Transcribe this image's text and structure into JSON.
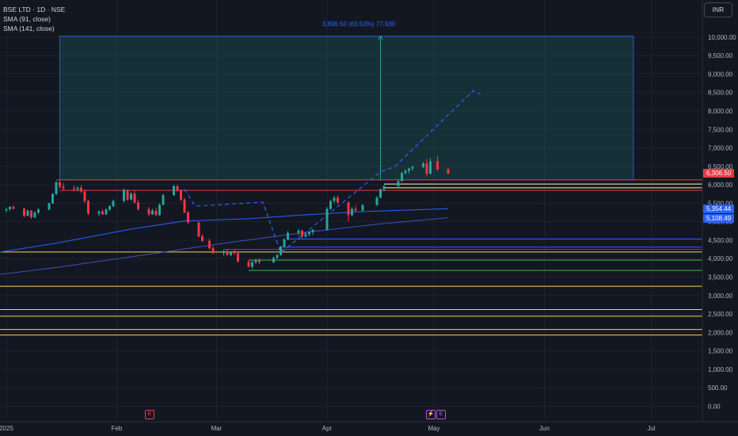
{
  "legend": {
    "symbol": "BSE LTD · 1D · NSE",
    "sma1": "SMA (91, close)",
    "sma2": "SMA (141, close)"
  },
  "currency": "INR",
  "measure_label": "3,896.50 (63.53%) 77,930",
  "events": [
    {
      "icon": "E",
      "date": "2025-02-06",
      "color": "#f23645"
    },
    {
      "icon": "⚡",
      "date": "2025-04-28",
      "color": "#b84fd6"
    },
    {
      "icon": "E",
      "date": "2025-05-01",
      "color": "#b84fd6"
    }
  ],
  "chart_data": {
    "type": "candlestick",
    "y_ticks": [
      "10,000.00",
      "9,500.00",
      "9,000.00",
      "8,500.00",
      "8,000.00",
      "7,500.00",
      "7,000.00",
      "6,500.00",
      "6,000.00",
      "5,500.00",
      "5,000.00",
      "4,500.00",
      "4,000.00",
      "3,500.00",
      "3,000.00",
      "2,500.00",
      "2,000.00",
      "1,500.00",
      "1,000.00",
      "500.00",
      "0.00"
    ],
    "y_tick_values": [
      10000,
      9500,
      9000,
      8500,
      8000,
      7500,
      7000,
      6500,
      6000,
      5500,
      5000,
      4500,
      4000,
      3500,
      3000,
      2500,
      2000,
      1500,
      1000,
      500,
      0
    ],
    "ylim": [
      -200,
      10900
    ],
    "x_ticks": [
      {
        "label": "2025",
        "date": "2025-01-01"
      },
      {
        "label": "Feb",
        "date": "2025-02-01"
      },
      {
        "label": "Mar",
        "date": "2025-03-01"
      },
      {
        "label": "Apr",
        "date": "2025-04-01"
      },
      {
        "label": "May",
        "date": "2025-05-01"
      },
      {
        "label": "Jun",
        "date": "2025-06-01"
      },
      {
        "label": "Jul",
        "date": "2025-07-01"
      }
    ],
    "candles": [
      {
        "date": "2025-01-01",
        "o": 5310,
        "h": 5380,
        "l": 5250,
        "c": 5340
      },
      {
        "date": "2025-01-02",
        "o": 5340,
        "h": 5420,
        "l": 5300,
        "c": 5400
      },
      {
        "date": "2025-01-03",
        "o": 5400,
        "h": 5440,
        "l": 5330,
        "c": 5350
      },
      {
        "date": "2025-01-06",
        "o": 5350,
        "h": 5380,
        "l": 5120,
        "c": 5160
      },
      {
        "date": "2025-01-07",
        "o": 5160,
        "h": 5330,
        "l": 5140,
        "c": 5300
      },
      {
        "date": "2025-01-08",
        "o": 5300,
        "h": 5320,
        "l": 5080,
        "c": 5120
      },
      {
        "date": "2025-01-09",
        "o": 5120,
        "h": 5280,
        "l": 5090,
        "c": 5250
      },
      {
        "date": "2025-01-10",
        "o": 5250,
        "h": 5360,
        "l": 5200,
        "c": 5330
      },
      {
        "date": "2025-01-13",
        "o": 5330,
        "h": 5520,
        "l": 5310,
        "c": 5500
      },
      {
        "date": "2025-01-14",
        "o": 5500,
        "h": 5780,
        "l": 5480,
        "c": 5750
      },
      {
        "date": "2025-01-15",
        "o": 5750,
        "h": 6100,
        "l": 5720,
        "c": 6070
      },
      {
        "date": "2025-01-16",
        "o": 6070,
        "h": 6133,
        "l": 5900,
        "c": 5950
      },
      {
        "date": "2025-01-17",
        "o": 5950,
        "h": 6050,
        "l": 5860,
        "c": 5900
      },
      {
        "date": "2025-01-20",
        "o": 5900,
        "h": 5980,
        "l": 5820,
        "c": 5880
      },
      {
        "date": "2025-01-21",
        "o": 5880,
        "h": 5960,
        "l": 5820,
        "c": 5920
      },
      {
        "date": "2025-01-22",
        "o": 5920,
        "h": 5990,
        "l": 5780,
        "c": 5820
      },
      {
        "date": "2025-01-23",
        "o": 5820,
        "h": 5870,
        "l": 5500,
        "c": 5560
      },
      {
        "date": "2025-01-24",
        "o": 5560,
        "h": 5600,
        "l": 5180,
        "c": 5220
      },
      {
        "date": "2025-01-27",
        "o": 5220,
        "h": 5300,
        "l": 5150,
        "c": 5280
      },
      {
        "date": "2025-01-28",
        "o": 5280,
        "h": 5330,
        "l": 5180,
        "c": 5200
      },
      {
        "date": "2025-01-29",
        "o": 5200,
        "h": 5360,
        "l": 5180,
        "c": 5330
      },
      {
        "date": "2025-01-30",
        "o": 5330,
        "h": 5450,
        "l": 5290,
        "c": 5420
      },
      {
        "date": "2025-01-31",
        "o": 5420,
        "h": 5600,
        "l": 5400,
        "c": 5560
      },
      {
        "date": "2025-02-03",
        "o": 5560,
        "h": 5900,
        "l": 5520,
        "c": 5860
      },
      {
        "date": "2025-02-04",
        "o": 5860,
        "h": 5880,
        "l": 5560,
        "c": 5600
      },
      {
        "date": "2025-02-05",
        "o": 5600,
        "h": 5800,
        "l": 5580,
        "c": 5760
      },
      {
        "date": "2025-02-06",
        "o": 5760,
        "h": 5830,
        "l": 5480,
        "c": 5520
      },
      {
        "date": "2025-02-07",
        "o": 5520,
        "h": 5600,
        "l": 5300,
        "c": 5340
      },
      {
        "date": "2025-02-10",
        "o": 5340,
        "h": 5400,
        "l": 5150,
        "c": 5200
      },
      {
        "date": "2025-02-11",
        "o": 5200,
        "h": 5350,
        "l": 5180,
        "c": 5300
      },
      {
        "date": "2025-02-12",
        "o": 5300,
        "h": 5380,
        "l": 5150,
        "c": 5180
      },
      {
        "date": "2025-02-13",
        "o": 5180,
        "h": 5500,
        "l": 5160,
        "c": 5460
      },
      {
        "date": "2025-02-14",
        "o": 5460,
        "h": 5750,
        "l": 5440,
        "c": 5720
      },
      {
        "date": "2025-02-17",
        "o": 5720,
        "h": 6000,
        "l": 5700,
        "c": 5960
      },
      {
        "date": "2025-02-18",
        "o": 5960,
        "h": 6010,
        "l": 5800,
        "c": 5850
      },
      {
        "date": "2025-02-19",
        "o": 5850,
        "h": 5880,
        "l": 5560,
        "c": 5600
      },
      {
        "date": "2025-02-20",
        "o": 5600,
        "h": 5650,
        "l": 5230,
        "c": 5250
      },
      {
        "date": "2025-02-21",
        "o": 5250,
        "h": 5300,
        "l": 4950,
        "c": 4980
      },
      {
        "date": "2025-02-24",
        "o": 4980,
        "h": 5000,
        "l": 4580,
        "c": 4600
      },
      {
        "date": "2025-02-25",
        "o": 4600,
        "h": 4660,
        "l": 4460,
        "c": 4480
      },
      {
        "date": "2025-02-27",
        "o": 4480,
        "h": 4540,
        "l": 4250,
        "c": 4280
      },
      {
        "date": "2025-02-28",
        "o": 4280,
        "h": 4350,
        "l": 4120,
        "c": 4150
      },
      {
        "date": "2025-03-03",
        "o": 4150,
        "h": 4240,
        "l": 4080,
        "c": 4200
      },
      {
        "date": "2025-03-04",
        "o": 4200,
        "h": 4260,
        "l": 4080,
        "c": 4100
      },
      {
        "date": "2025-03-05",
        "o": 4100,
        "h": 4200,
        "l": 4060,
        "c": 4180
      },
      {
        "date": "2025-03-06",
        "o": 4180,
        "h": 4250,
        "l": 4100,
        "c": 4150
      },
      {
        "date": "2025-03-07",
        "o": 4150,
        "h": 4180,
        "l": 3900,
        "c": 3920
      },
      {
        "date": "2025-03-10",
        "o": 3920,
        "h": 3960,
        "l": 3760,
        "c": 3780
      },
      {
        "date": "2025-03-11",
        "o": 3780,
        "h": 3950,
        "l": 3720,
        "c": 3900
      },
      {
        "date": "2025-03-12",
        "o": 3900,
        "h": 4000,
        "l": 3850,
        "c": 3960
      },
      {
        "date": "2025-03-13",
        "o": 3960,
        "h": 4010,
        "l": 3860,
        "c": 3900
      },
      {
        "date": "2025-03-17",
        "o": 3900,
        "h": 4060,
        "l": 3880,
        "c": 4020
      },
      {
        "date": "2025-03-18",
        "o": 4020,
        "h": 4120,
        "l": 3980,
        "c": 4100
      },
      {
        "date": "2025-03-19",
        "o": 4100,
        "h": 4350,
        "l": 4080,
        "c": 4320
      },
      {
        "date": "2025-03-20",
        "o": 4320,
        "h": 4560,
        "l": 4300,
        "c": 4520
      },
      {
        "date": "2025-03-21",
        "o": 4520,
        "h": 4750,
        "l": 4500,
        "c": 4700
      },
      {
        "date": "2025-03-24",
        "o": 4700,
        "h": 4800,
        "l": 4620,
        "c": 4760
      },
      {
        "date": "2025-03-25",
        "o": 4760,
        "h": 4780,
        "l": 4550,
        "c": 4600
      },
      {
        "date": "2025-03-26",
        "o": 4600,
        "h": 4700,
        "l": 4560,
        "c": 4660
      },
      {
        "date": "2025-03-27",
        "o": 4660,
        "h": 4760,
        "l": 4600,
        "c": 4720
      },
      {
        "date": "2025-03-28",
        "o": 4720,
        "h": 4800,
        "l": 4640,
        "c": 4780
      },
      {
        "date": "2025-04-01",
        "o": 4780,
        "h": 5400,
        "l": 4760,
        "c": 5350
      },
      {
        "date": "2025-04-02",
        "o": 5350,
        "h": 5600,
        "l": 5320,
        "c": 5560
      },
      {
        "date": "2025-04-03",
        "o": 5560,
        "h": 5700,
        "l": 5500,
        "c": 5650
      },
      {
        "date": "2025-04-04",
        "o": 5650,
        "h": 5720,
        "l": 5480,
        "c": 5520
      },
      {
        "date": "2025-04-07",
        "o": 5520,
        "h": 5560,
        "l": 5000,
        "c": 5180
      },
      {
        "date": "2025-04-08",
        "o": 5180,
        "h": 5400,
        "l": 5150,
        "c": 5350
      },
      {
        "date": "2025-04-09",
        "o": 5350,
        "h": 5450,
        "l": 5250,
        "c": 5300
      },
      {
        "date": "2025-04-11",
        "o": 5300,
        "h": 5480,
        "l": 5280,
        "c": 5450
      },
      {
        "date": "2025-04-15",
        "o": 5450,
        "h": 5700,
        "l": 5430,
        "c": 5650
      },
      {
        "date": "2025-04-16",
        "o": 5650,
        "h": 5900,
        "l": 5640,
        "c": 5880
      },
      {
        "date": "2025-04-17",
        "o": 5880,
        "h": 6000,
        "l": 5820,
        "c": 5960
      },
      {
        "date": "2025-04-21",
        "o": 5960,
        "h": 6150,
        "l": 5940,
        "c": 6100
      },
      {
        "date": "2025-04-22",
        "o": 6100,
        "h": 6350,
        "l": 6080,
        "c": 6320
      },
      {
        "date": "2025-04-23",
        "o": 6320,
        "h": 6420,
        "l": 6280,
        "c": 6380
      },
      {
        "date": "2025-04-24",
        "o": 6380,
        "h": 6460,
        "l": 6300,
        "c": 6440
      },
      {
        "date": "2025-04-25",
        "o": 6440,
        "h": 6520,
        "l": 6380,
        "c": 6480
      },
      {
        "date": "2025-04-28",
        "o": 6480,
        "h": 6620,
        "l": 6460,
        "c": 6580
      },
      {
        "date": "2025-04-29",
        "o": 6580,
        "h": 6700,
        "l": 6220,
        "c": 6300
      },
      {
        "date": "2025-04-30",
        "o": 6300,
        "h": 6720,
        "l": 6280,
        "c": 6640
      },
      {
        "date": "2025-05-02",
        "o": 6640,
        "h": 6780,
        "l": 6380,
        "c": 6420
      },
      {
        "date": "2025-05-05",
        "o": 6420,
        "h": 6460,
        "l": 6280,
        "c": 6306.5
      }
    ],
    "sma_91": [
      {
        "date": "2024-12-20",
        "v": 4020
      },
      {
        "date": "2025-01-15",
        "v": 4420
      },
      {
        "date": "2025-02-05",
        "v": 4800
      },
      {
        "date": "2025-02-20",
        "v": 5020
      },
      {
        "date": "2025-03-10",
        "v": 5080
      },
      {
        "date": "2025-03-25",
        "v": 5180
      },
      {
        "date": "2025-04-10",
        "v": 5270
      },
      {
        "date": "2025-05-05",
        "v": 5354.44
      }
    ],
    "sma_141": [
      {
        "date": "2024-12-20",
        "v": 3450
      },
      {
        "date": "2025-01-15",
        "v": 3760
      },
      {
        "date": "2025-02-10",
        "v": 4120
      },
      {
        "date": "2025-03-01",
        "v": 4390
      },
      {
        "date": "2025-03-25",
        "v": 4700
      },
      {
        "date": "2025-04-15",
        "v": 4930
      },
      {
        "date": "2025-05-05",
        "v": 5108.49
      }
    ],
    "horizontal_lines": [
      {
        "value": 6133,
        "color": "#f23645",
        "from": "2025-01-15"
      },
      {
        "value": 6020,
        "color": "#f7f7a8",
        "from": "2025-04-17"
      },
      {
        "value": 5920,
        "color": "#f7f7a8",
        "from": "2025-04-17"
      },
      {
        "value": 5850,
        "color": "#f23645",
        "from": "2025-01-16"
      },
      {
        "value": 4530,
        "color": "#2962ff",
        "from": "2025-03-21"
      },
      {
        "value": 4310,
        "color": "#2962ff",
        "from": "2025-03-19"
      },
      {
        "value": 4250,
        "color": "#9c27b0",
        "from": "2025-03-03"
      },
      {
        "value": 4180,
        "color": "#f7d35a",
        "from": "2024-12-20"
      },
      {
        "value": 3960,
        "color": "#4caf50",
        "from": "2025-03-10"
      },
      {
        "value": 3680,
        "color": "#4caf50",
        "from": "2025-03-10"
      },
      {
        "value": 3250,
        "color": "#f7d35a",
        "from": "2024-12-20"
      },
      {
        "value": 2620,
        "color": "#f7d35a",
        "from": "2024-12-20"
      },
      {
        "value": 2440,
        "color": "#f7d35a",
        "from": "2024-12-20"
      },
      {
        "value": 2080,
        "color": "#f7d35a",
        "from": "2024-12-20"
      },
      {
        "value": 1930,
        "color": "#f7d35a",
        "from": "2024-12-20"
      }
    ],
    "measure_box": {
      "from_date": "2025-01-16",
      "to_date": "2025-06-26",
      "low": 6133,
      "high": 10030,
      "arrow_date": "2025-04-16"
    },
    "projection_path": [
      {
        "date": "2025-02-20",
        "v": 5880
      },
      {
        "date": "2025-02-23",
        "v": 5420
      },
      {
        "date": "2025-03-14",
        "v": 5530
      },
      {
        "date": "2025-03-19",
        "v": 4160
      },
      {
        "date": "2025-04-16",
        "v": 6350
      },
      {
        "date": "2025-04-20",
        "v": 6490
      },
      {
        "date": "2025-05-12",
        "v": 8550
      },
      {
        "date": "2025-05-14",
        "v": 8450
      }
    ],
    "last_price": {
      "value": 6306.5,
      "label": "6,306.50",
      "color": "#f23645"
    },
    "sma_91_label": {
      "value": 5354.44,
      "label": "5,354.44",
      "color": "#2962ff"
    },
    "sma_141_label": {
      "value": 5108.49,
      "label": "5,108.49",
      "color": "#2962ff"
    },
    "colors": {
      "up": "#26a69a",
      "down": "#f23645",
      "background": "#131722",
      "grid": "#1e222d",
      "text": "#b2b5be"
    }
  }
}
